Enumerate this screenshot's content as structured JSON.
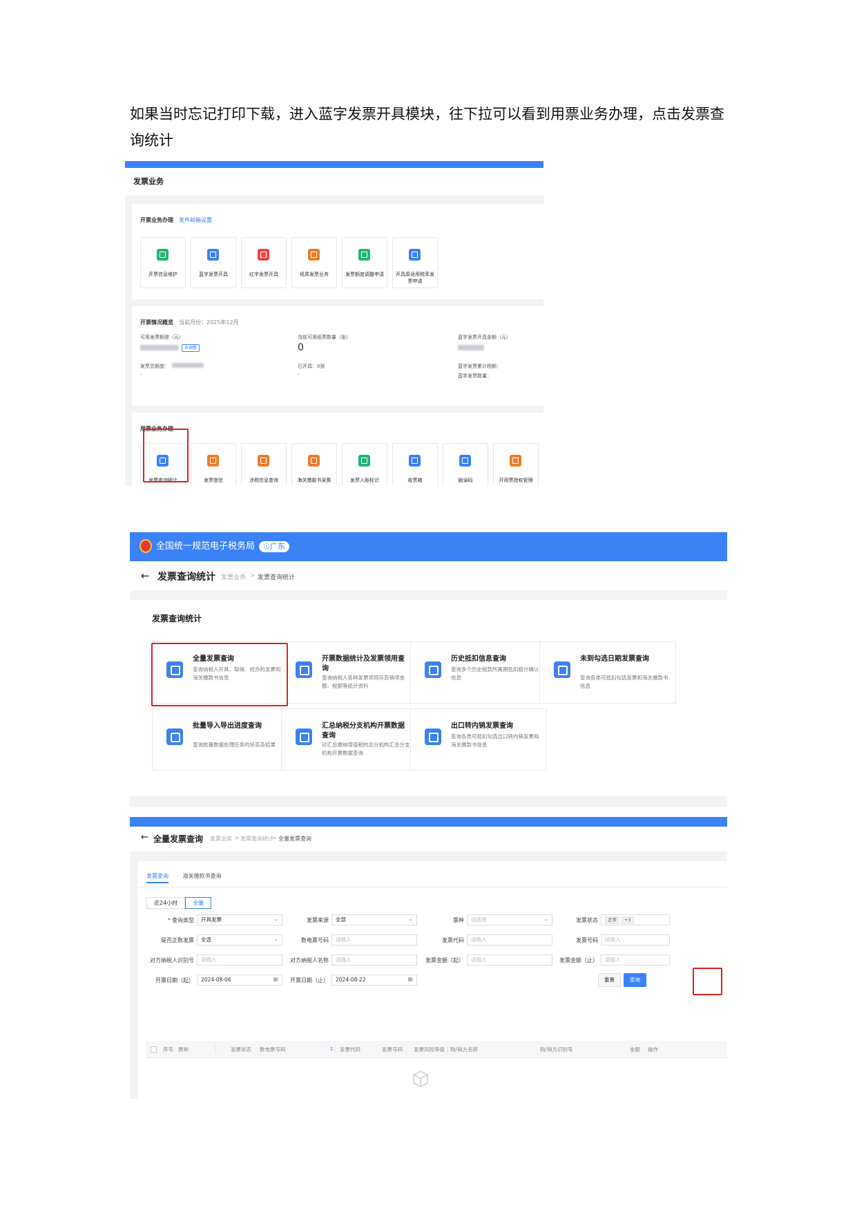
{
  "intro_text": "如果当时忘记打印下载，进入蓝字发票开具模块，往下拉可以看到用票业务办理，点击发票查询统计",
  "shot1": {
    "header": "发票业务",
    "issuing": {
      "title": "开票业务办理",
      "link": "发件邮箱设置",
      "tiles": [
        {
          "label": "开票信息维护",
          "color": "#22b573",
          "icon": "edit-icon"
        },
        {
          "label": "蓝字发票开具",
          "color": "#3b82f6",
          "icon": "ticket-icon"
        },
        {
          "label": "红字发票开具",
          "color": "#ef4444",
          "icon": "ticket-icon"
        },
        {
          "label": "纸质发票业务",
          "color": "#f07c2a",
          "icon": "paper-icon"
        },
        {
          "label": "发票额度调整申请",
          "color": "#22b573",
          "icon": "adjust-icon"
        },
        {
          "label": "开具原适用税率发票申请",
          "color": "#3b82f6",
          "icon": "apply-icon"
        }
      ]
    },
    "overview": {
      "title": "开票情况概览",
      "month": "当前月份：2025年12月",
      "available_quota_label": "可用发票额度（元）",
      "adjust_badge": "去调整",
      "total_quota_label": "发票总额度：",
      "dash1": "-",
      "paper_count_label": "当前可用纸票数量（张）",
      "paper_count": "0",
      "issued_label": "已开具：",
      "issued_value": "0张",
      "dash2": "-",
      "blue_amount_label": "蓝字发票开具金额（元）",
      "blue_tax_label": "蓝字发票累计税额：",
      "blue_count_label": "蓝字发票数量："
    },
    "usage": {
      "title": "用票业务办理",
      "tiles": [
        {
          "label": "发票查询统计",
          "color": "#3b82f6",
          "icon": "search-doc-icon"
        },
        {
          "label": "发票查验",
          "color": "#f07c2a",
          "icon": "verify-icon"
        },
        {
          "label": "涉税信息查询",
          "color": "#f07c2a",
          "icon": "info-icon"
        },
        {
          "label": "海关缴款书采集",
          "color": "#f07c2a",
          "icon": "collect-icon"
        },
        {
          "label": "发票入账标识",
          "color": "#22b573",
          "icon": "mark-icon"
        },
        {
          "label": "收票箱",
          "color": "#3b82f6",
          "icon": "mailbox-icon"
        },
        {
          "label": "勘误码",
          "color": "#3b82f6",
          "icon": "qrcode-icon"
        },
        {
          "label": "开用票授权管理",
          "color": "#f07c2a",
          "icon": "auth-icon"
        }
      ]
    }
  },
  "shot2": {
    "brand": "全国统一规范电子税务局",
    "region": "广东",
    "back_glyph": "←",
    "nav_title": "发票查询统计",
    "crumb_parent": "发票业务",
    "crumb_sep": ">",
    "crumb_current": "发票查询统计",
    "panel_title": "发票查询统计",
    "cards": [
      {
        "title": "全量发票查询",
        "desc": "查询纳税人开具、取得、经办的发票和海关缴款书信息"
      },
      {
        "title": "开票数据统计及发票领用查询",
        "desc": "查询纳税人各种发票领用存及销项金额、税额等统计资料"
      },
      {
        "title": "历史抵扣信息查询",
        "desc": "查询多个历史税款所属期抵扣统计确认信息"
      },
      {
        "title": "未到勾选日期发票查询",
        "desc": "查询各类可抵扣勾选发票和海关缴款书信息"
      },
      {
        "title": "批量导入导出进度查询",
        "desc": "查询批量数据处理任务的状态及结果"
      },
      {
        "title": "汇总纳税分支机构开票数据查询",
        "desc": "对汇总缴纳增值税的总分机构汇总分支机构开票数据查询"
      },
      {
        "title": "出口转内销发票查询",
        "desc": "查询各类可抵扣勾选出口转内销发票和海关缴款书信息"
      }
    ]
  },
  "shot3": {
    "back_glyph": "←",
    "nav_title": "全量发票查询",
    "crumb_1": "发票业务",
    "crumb_2": "发票查询统计",
    "crumb_3": "全量发票查询",
    "crumb_sep": ">",
    "tabs": [
      "发票查询",
      "海关缴款书查询"
    ],
    "seg": [
      "近24小时",
      "全量"
    ],
    "fields": {
      "query_type": {
        "label": "查询类型",
        "value": "开具发票"
      },
      "source": {
        "label": "发票来源",
        "value": "全部"
      },
      "ticket_type": {
        "label": "票种",
        "placeholder": "请选择"
      },
      "status": {
        "label": "发票状态",
        "tag1": "正常",
        "tag2": "+3"
      },
      "positive": {
        "label": "是否正数发票",
        "value": "全选"
      },
      "e_number": {
        "label": "数电票号码",
        "placeholder": "请输入"
      },
      "code": {
        "label": "发票代码",
        "placeholder": "请输入"
      },
      "number": {
        "label": "发票号码",
        "placeholder": "请输入"
      },
      "taxpayer_id": {
        "label": "对方纳税人识别号",
        "placeholder": "请输入"
      },
      "taxpayer_name": {
        "label": "对方纳税人名称",
        "placeholder": "请输入"
      },
      "amount_from": {
        "label": "发票金额（起）",
        "placeholder": "请输入"
      },
      "amount_to": {
        "label": "发票金额（止）",
        "placeholder": "请输入"
      },
      "date_from": {
        "label": "开票日期（起）",
        "value": "2024-08-06"
      },
      "date_to": {
        "label": "开票日期（止）",
        "value": "2024-08-22"
      }
    },
    "reset_label": "重置",
    "query_label": "查询",
    "columns": [
      "序号",
      "票种",
      "发票状态",
      "数电票号码",
      "发票代码",
      "发票号码",
      "发票风险等级",
      "购/销方名称",
      "购/销方识别号",
      "金额",
      "操作"
    ]
  }
}
